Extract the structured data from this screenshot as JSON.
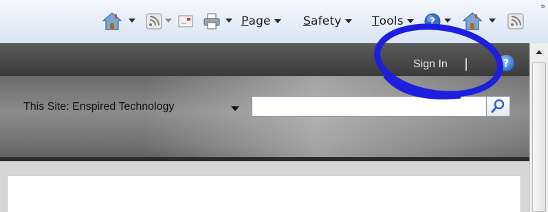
{
  "commandbar": {
    "home_icon": "home-icon",
    "feeds_icon": "rss-feed-icon",
    "mail_icon": "mail-icon",
    "print_icon": "printer-icon",
    "page_menu": {
      "accel": "P",
      "rest": "age"
    },
    "safety_menu": {
      "accel": "S",
      "rest": "afety"
    },
    "tools_menu": {
      "accel": "T",
      "rest": "ools"
    },
    "help_icon": "help-icon",
    "overflow": "»"
  },
  "header": {
    "sign_in": "Sign In",
    "help_glyph": "?",
    "search_scope": "This Site: Enspired Technology",
    "search_value": "",
    "search_icon": "magnifier-icon"
  },
  "annotation": {
    "color": "#1e1ee0"
  }
}
